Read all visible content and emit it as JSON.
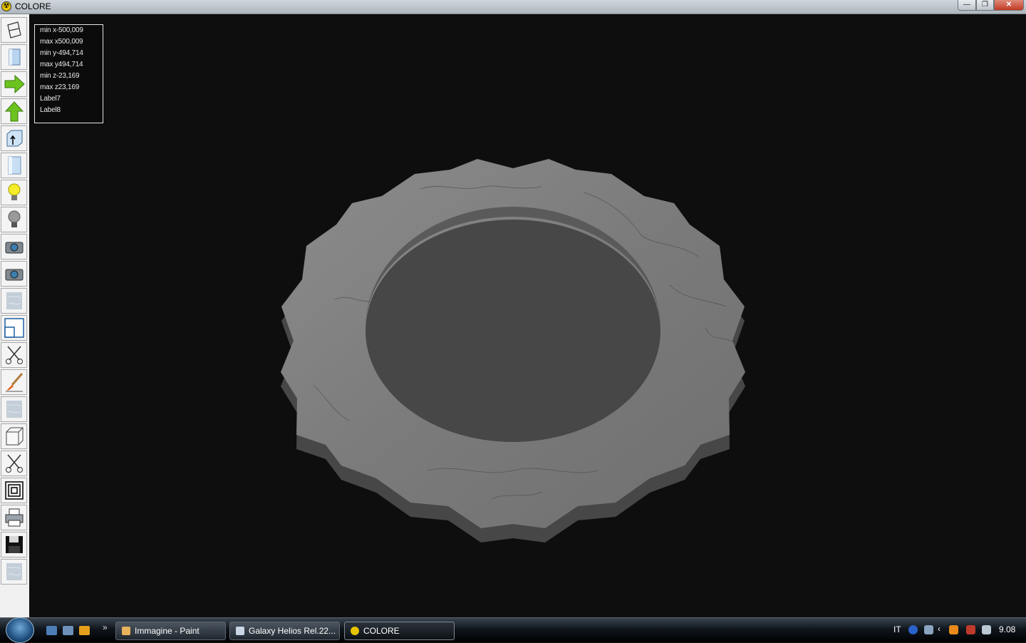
{
  "window": {
    "title": "COLORE",
    "minimize_glyph": "—",
    "maximize_glyph": "❐",
    "close_glyph": "✕"
  },
  "toolbar": {
    "tools": [
      {
        "name": "wireframe-icon"
      },
      {
        "name": "solid-view-icon"
      },
      {
        "name": "arrow-right-icon"
      },
      {
        "name": "arrow-up-icon"
      },
      {
        "name": "box-arrow-icon"
      },
      {
        "name": "panel-icon"
      },
      {
        "name": "light-on-icon"
      },
      {
        "name": "light-off-icon"
      },
      {
        "name": "camera-icon"
      },
      {
        "name": "camera-2-icon"
      },
      {
        "name": "marble-texture-icon"
      },
      {
        "name": "window-resize-icon"
      },
      {
        "name": "scissors-icon"
      },
      {
        "name": "paintbrush-icon"
      },
      {
        "name": "marble-texture-2-icon"
      },
      {
        "name": "cube-icon"
      },
      {
        "name": "scissors-2-icon"
      },
      {
        "name": "concentric-squares-icon"
      },
      {
        "name": "printer-icon"
      },
      {
        "name": "floppy-save-icon"
      },
      {
        "name": "marble-texture-3-icon"
      }
    ]
  },
  "info": {
    "min_x": "min x-500,009",
    "max_x": "max x500,009",
    "min_y": "min y-494,714",
    "max_y": "max y494,714",
    "min_z": "min z-23,169",
    "max_z": "max z23,169",
    "label7": "Label7",
    "label8": "Label8"
  },
  "taskbar": {
    "quicklaunch_chevron": "»",
    "buttons": [
      {
        "label": "Immagine - Paint",
        "icon": "paint-icon"
      },
      {
        "label": "Galaxy Helios  Rel.22...",
        "icon": "explorer-icon"
      },
      {
        "label": "COLORE",
        "icon": "colore-icon"
      }
    ],
    "language": "IT",
    "clock": "9.08"
  },
  "colors": {
    "viewport_bg": "#0e0e0e",
    "marble_top": "#7d7d7d",
    "marble_side": "#555555"
  }
}
